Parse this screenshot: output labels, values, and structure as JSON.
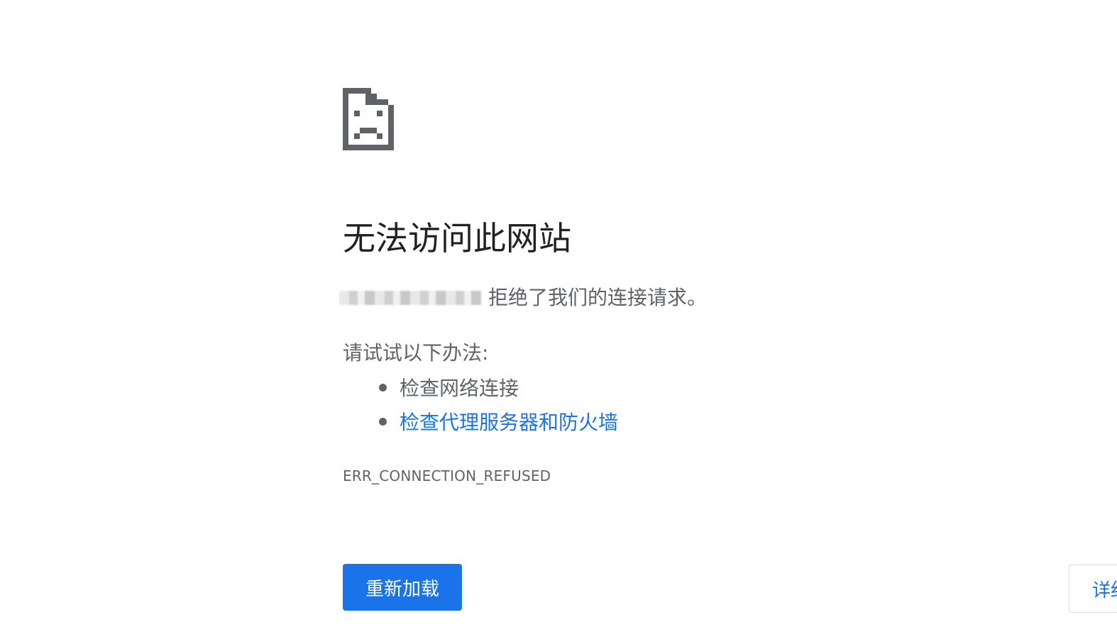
{
  "error_page": {
    "icon": "sad-page-icon",
    "title": "无法访问此网站",
    "message_suffix": "拒绝了我们的连接请求。",
    "suggestions_heading": "请试试以下办法:",
    "suggestions": [
      {
        "label": "检查网络连接",
        "is_link": false
      },
      {
        "label": "检查代理服务器和防火墙",
        "is_link": true
      }
    ],
    "error_code": "ERR_CONNECTION_REFUSED",
    "reload_label": "重新加载",
    "details_label": "详细信息"
  },
  "colors": {
    "accent": "#1a73e8",
    "title": "#202124",
    "body": "#5f6368",
    "icon": "#5f6368"
  }
}
